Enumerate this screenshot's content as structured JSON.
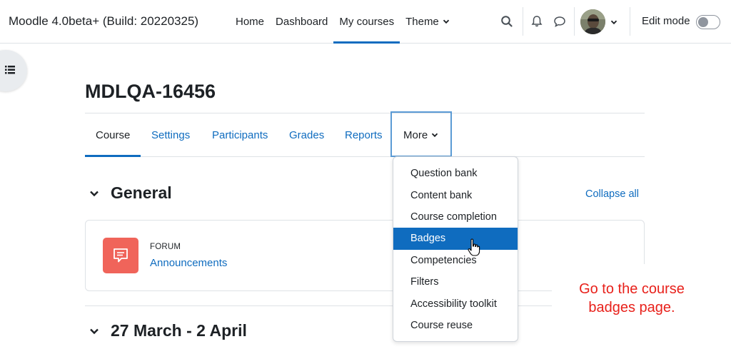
{
  "app": {
    "title": "Moodle 4.0beta+ (Build: 20220325)"
  },
  "primary_nav": [
    {
      "label": "Home",
      "active": false
    },
    {
      "label": "Dashboard",
      "active": false
    },
    {
      "label": "My courses",
      "active": true
    },
    {
      "label": "Theme",
      "active": false,
      "has_dropdown": true
    }
  ],
  "navbar_icons": [
    "search-icon",
    "bell-icon",
    "chat-icon",
    "chevron-down-icon"
  ],
  "edit_mode": {
    "label": "Edit mode",
    "on": false
  },
  "course": {
    "title": "MDLQA-16456"
  },
  "secondary_nav": [
    {
      "label": "Course",
      "active": true
    },
    {
      "label": "Settings",
      "active": false
    },
    {
      "label": "Participants",
      "active": false
    },
    {
      "label": "Grades",
      "active": false
    },
    {
      "label": "Reports",
      "active": false
    },
    {
      "label": "More",
      "active": false,
      "has_dropdown": true
    }
  ],
  "more_menu": {
    "items": [
      {
        "label": "Question bank",
        "selected": false
      },
      {
        "label": "Content bank",
        "selected": false
      },
      {
        "label": "Course completion",
        "selected": false
      },
      {
        "label": "Badges",
        "selected": true
      },
      {
        "label": "Competencies",
        "selected": false
      },
      {
        "label": "Filters",
        "selected": false
      },
      {
        "label": "Accessibility toolkit",
        "selected": false
      },
      {
        "label": "Course reuse",
        "selected": false
      }
    ]
  },
  "sections": [
    {
      "title": "General",
      "collapse_all_label": "Collapse all",
      "activities": [
        {
          "type_label": "FORUM",
          "name": "Announcements",
          "icon": "forum-icon"
        }
      ]
    },
    {
      "title": "27 March - 2 April"
    }
  ],
  "annotation": {
    "line1": "Go to the course",
    "line2": "badges page."
  },
  "colors": {
    "accent": "#0f6cbf",
    "forum_icon_bg": "#f0645a",
    "annotation_text": "#e8211b",
    "highlight_box": "#5b9bd5"
  }
}
